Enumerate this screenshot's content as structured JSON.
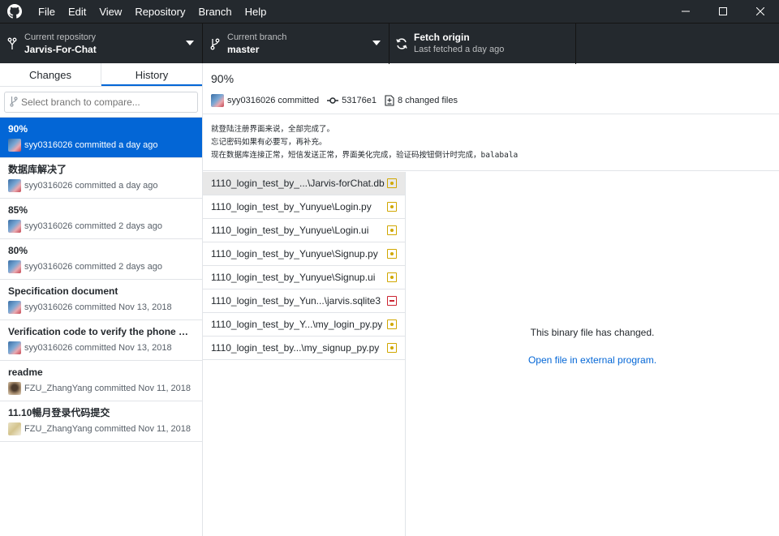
{
  "menu": [
    "File",
    "Edit",
    "View",
    "Repository",
    "Branch",
    "Help"
  ],
  "toolbar": {
    "repo_label": "Current repository",
    "repo_value": "Jarvis-For-Chat",
    "branch_label": "Current branch",
    "branch_value": "master",
    "fetch_title": "Fetch origin",
    "fetch_sub": "Last fetched a day ago"
  },
  "sidebar": {
    "tabs": [
      "Changes",
      "History"
    ],
    "compare_placeholder": "Select branch to compare...",
    "commits": [
      {
        "summary": "90%",
        "meta": "syy0316026 committed a day ago"
      },
      {
        "summary": "数据库解决了",
        "meta": "syy0316026 committed a day ago"
      },
      {
        "summary": "85%",
        "meta": "syy0316026 committed 2 days ago"
      },
      {
        "summary": "80%",
        "meta": "syy0316026 committed 2 days ago"
      },
      {
        "summary": "Specification document",
        "meta": "syy0316026 committed Nov 13, 2018"
      },
      {
        "summary": "Verification code to verify the phone nu...",
        "meta": "syy0316026 committed Nov 13, 2018"
      },
      {
        "summary": "readme",
        "meta": "FZU_ZhangYang committed Nov 11, 2018"
      },
      {
        "summary": "11.10暢月登录代码提交",
        "meta": "FZU_ZhangYang committed Nov 11, 2018"
      }
    ]
  },
  "commit": {
    "title": "90%",
    "author": "syy0316026 committed",
    "sha": "53176e1",
    "changed_files": "8 changed files",
    "description": [
      "就登陆注册界面来说，全部完成了。",
      "忘记密码如果有必要写，再补充。",
      "现在数据库连接正常，短信发送正常，界面美化完成，验证码按钮倒计时完成，balabala"
    ]
  },
  "files": [
    {
      "path": "1110_login_test_by_...\\Jarvis-forChat.db",
      "status": "modified"
    },
    {
      "path": "1110_login_test_by_Yunyue\\Login.py",
      "status": "modified"
    },
    {
      "path": "1110_login_test_by_Yunyue\\Login.ui",
      "status": "modified"
    },
    {
      "path": "1110_login_test_by_Yunyue\\Signup.py",
      "status": "modified"
    },
    {
      "path": "1110_login_test_by_Yunyue\\Signup.ui",
      "status": "modified"
    },
    {
      "path": "1110_login_test_by_Yun...\\jarvis.sqlite3",
      "status": "deleted"
    },
    {
      "path": "1110_login_test_by_Y...\\my_login_py.py",
      "status": "modified"
    },
    {
      "path": "1110_login_test_by...\\my_signup_py.py",
      "status": "modified"
    }
  ],
  "diff": {
    "message": "This binary file has changed.",
    "link": "Open file in external program."
  },
  "colors": {
    "dark_bar": "#24292e",
    "selection": "#0366d6",
    "modified": "#d0a700",
    "deleted": "#cb2431"
  },
  "icons": {
    "app": "github-logo-icon",
    "repo": "repo-icon",
    "branch": "branch-icon",
    "fetch": "sync-icon",
    "compare": "branch-compare-icon",
    "sha": "commit-icon",
    "files": "diff-file-icon"
  }
}
